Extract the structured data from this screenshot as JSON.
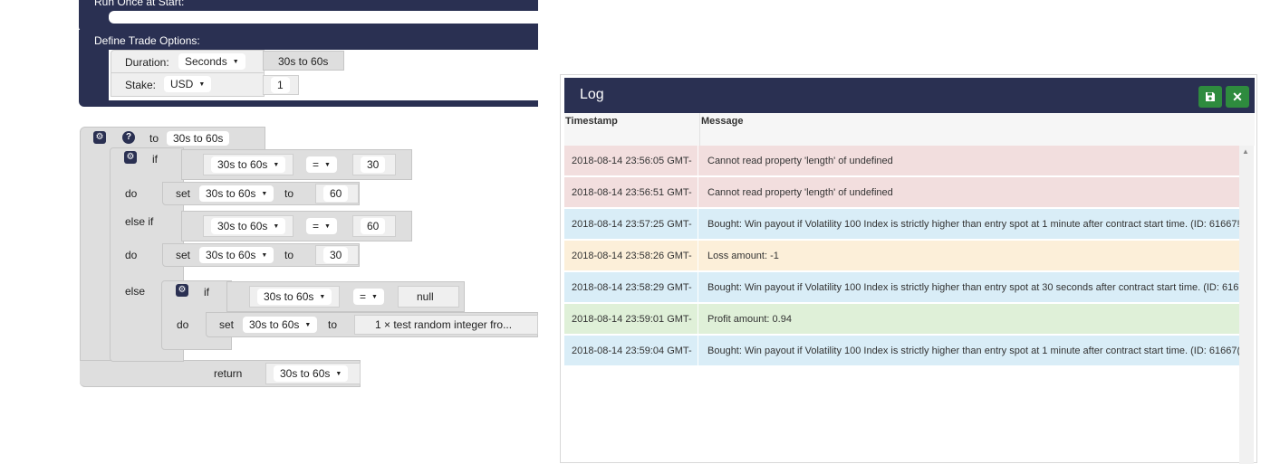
{
  "blocks": {
    "run_once_label": "Run Once at Start:",
    "define_trade_label": "Define Trade Options:",
    "duration_label": "Duration:",
    "duration_unit": "Seconds",
    "duration_value": "30s to 60s",
    "stake_label": "Stake:",
    "stake_currency": "USD",
    "stake_value": "1",
    "function": {
      "to_label": "to",
      "name": "30s to 60s",
      "if_label": "if",
      "do_label": "do",
      "else_if_label": "else if",
      "else_label": "else",
      "set_label": "set",
      "var_name": "30s to 60s",
      "eq_op": "=",
      "cond1_value": "30",
      "set1_value": "60",
      "cond2_value": "60",
      "set2_value": "30",
      "null_value": "null",
      "random_block": "1 × test random integer fro...",
      "return_label": "return",
      "return_value": "30s to 60s"
    }
  },
  "log": {
    "title": "Log",
    "save_icon": "floppy-disk-icon",
    "close_icon": "close-icon",
    "columns": [
      "Timestamp",
      "Message"
    ],
    "rows": [
      {
        "timestamp": "2018-08-14 23:56:05 GMT-",
        "message": "Cannot read property 'length' of undefined",
        "severity": "error"
      },
      {
        "timestamp": "2018-08-14 23:56:51 GMT-",
        "message": "Cannot read property 'length' of undefined",
        "severity": "error"
      },
      {
        "timestamp": "2018-08-14 23:57:25 GMT-",
        "message": "Bought: Win payout if Volatility 100 Index is strictly higher than entry spot at 1 minute after contract start time. (ID: 61667!",
        "severity": "info"
      },
      {
        "timestamp": "2018-08-14 23:58:26 GMT-",
        "message": "Loss amount: -1",
        "severity": "warn"
      },
      {
        "timestamp": "2018-08-14 23:58:29 GMT-",
        "message": "Bought: Win payout if Volatility 100 Index is strictly higher than entry spot at 30 seconds after contract start time. (ID: 616",
        "severity": "info"
      },
      {
        "timestamp": "2018-08-14 23:59:01 GMT-",
        "message": "Profit amount: 0.94",
        "severity": "success"
      },
      {
        "timestamp": "2018-08-14 23:59:04 GMT-",
        "message": "Bought: Win payout if Volatility 100 Index is strictly higher than entry spot at 1 minute after contract start time. (ID: 61667(",
        "severity": "info"
      }
    ],
    "colors": {
      "error": "#f2dede",
      "info": "#d9edf7",
      "warn": "#fcefd9",
      "success": "#dff0d8"
    }
  }
}
